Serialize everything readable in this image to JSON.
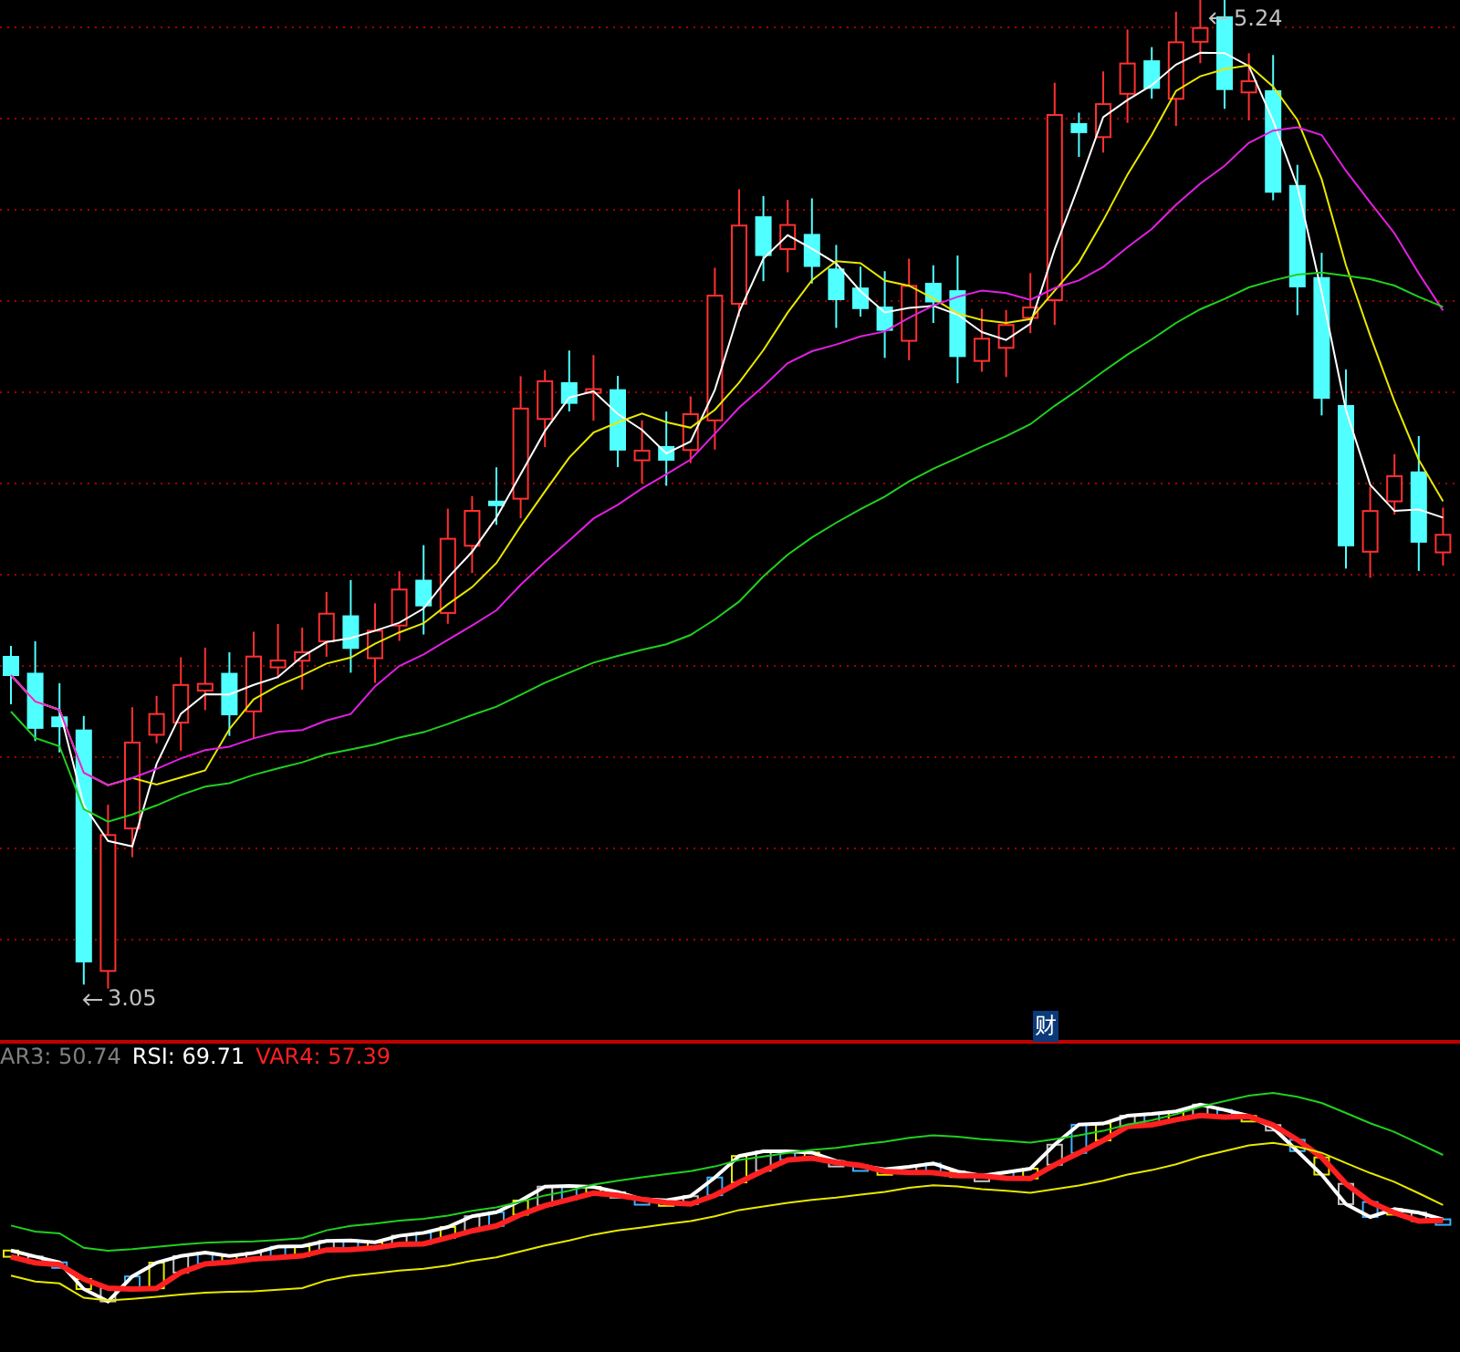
{
  "main_chart": {
    "high_label": "5.24",
    "low_label": "3.05",
    "badge": "财"
  },
  "indicator": {
    "legend": [
      {
        "text": "AR3: 50.74",
        "color": "#808080"
      },
      {
        "text": "RSI: 69.71",
        "color": "#ffffff"
      },
      {
        "text": "VAR4: 57.39",
        "color": "#ff2020"
      }
    ]
  }
}
